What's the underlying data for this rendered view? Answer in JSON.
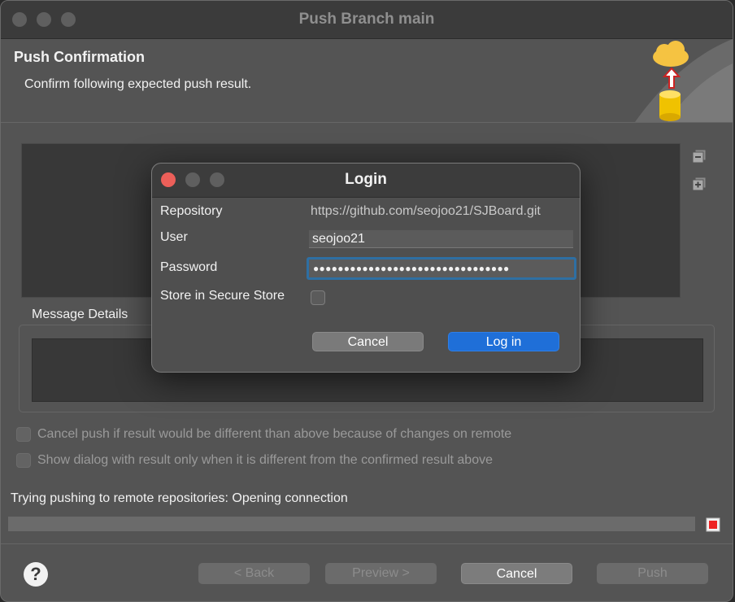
{
  "window": {
    "title": "Push Branch main",
    "header_title": "Push Confirmation",
    "header_desc": "Confirm following expected push result."
  },
  "message": {
    "label": "Message Details"
  },
  "options": [
    {
      "label": "Cancel push if result would be different than above because of changes on remote",
      "checked": false,
      "enabled": false
    },
    {
      "label": "Show dialog with result only when it is different from the confirmed result above",
      "checked": false,
      "enabled": false
    }
  ],
  "status": {
    "text": "Trying pushing to remote repositories: Opening connection",
    "progress": 0.0
  },
  "footer": {
    "help_label": "?",
    "back_label": "< Back",
    "preview_label": "Preview >",
    "cancel_label": "Cancel",
    "push_label": "Push"
  },
  "login": {
    "title": "Login",
    "repository_label": "Repository",
    "repository_value": "https://github.com/seojoo21/SJBoard.git",
    "user_label": "User",
    "user_value": "seojoo21",
    "password_label": "Password",
    "password_mask": "●●●●●●●●●●●●●●●●●●●●●●●●●●●●●●●●",
    "store_label": "Store in Secure Store",
    "store_checked": false,
    "cancel_label": "Cancel",
    "login_label": "Log in"
  },
  "colors": {
    "accent": "#1f6fd8",
    "close_red": "#ec5f59",
    "focus_ring": "#2e6fa3"
  },
  "icons": [
    "collapse-all-icon",
    "expand-all-icon",
    "push-cloud-icon",
    "stop-icon",
    "help-icon"
  ]
}
